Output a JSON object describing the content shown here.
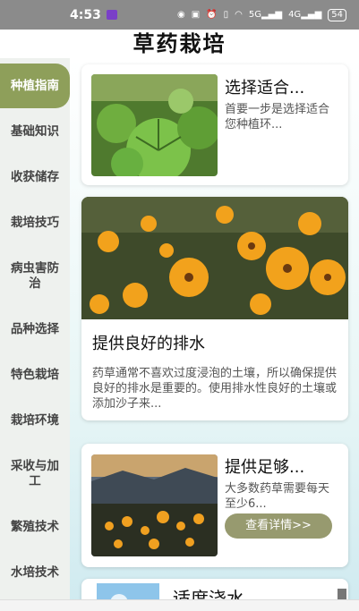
{
  "status_bar": {
    "time": "4:53",
    "icons": [
      "eye-icon",
      "nfc-icon",
      "alarm-icon",
      "vibrate-icon",
      "wifi-icon",
      "signal-5g-icon",
      "signal-4g-icon"
    ],
    "network_5g": "5G",
    "network_4g": "4G",
    "battery": "54"
  },
  "header": {
    "title": "草药栽培"
  },
  "sidebar": {
    "items": [
      {
        "label": "种植指南",
        "active": true
      },
      {
        "label": "基础知识"
      },
      {
        "label": "收获储存"
      },
      {
        "label": "栽培技巧"
      },
      {
        "label": "病虫害防治"
      },
      {
        "label": "品种选择"
      },
      {
        "label": "特色栽培"
      },
      {
        "label": "栽培环境"
      },
      {
        "label": "采收与加工"
      },
      {
        "label": "繁殖技术"
      },
      {
        "label": "水培技术"
      }
    ]
  },
  "cards": [
    {
      "title": "选择适合...",
      "desc": "首要一步是选择适合您种植环..."
    },
    {
      "title": "提供良好的排水",
      "desc": "药草通常不喜欢过度浸泡的土壤，所以确保提供良好的排水是重要的。使用排水性良好的土壤或添加沙子来..."
    },
    {
      "title": "提供足够...",
      "desc": "大多数药草需要每天至少6...",
      "button": "查看详情>>"
    },
    {
      "title": "适度浇水"
    }
  ],
  "colors": {
    "accent": "#8e9f5a",
    "button": "#979a6f"
  }
}
